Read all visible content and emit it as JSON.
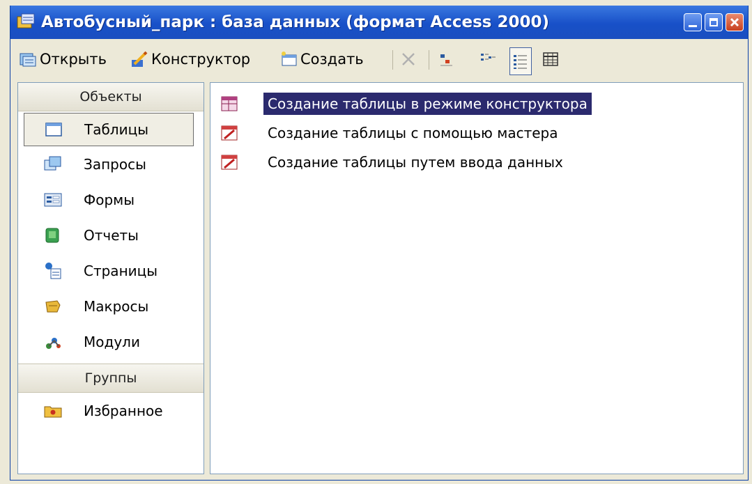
{
  "window": {
    "title": "Автобусный_парк : база данных (формат Access 2000)"
  },
  "toolbar": {
    "open_label": "Открыть",
    "design_label": "Конструктор",
    "create_label": "Создать"
  },
  "objects_panel": {
    "header": "Объекты",
    "items": [
      {
        "label": "Таблицы",
        "icon": "table-icon"
      },
      {
        "label": "Запросы",
        "icon": "query-icon"
      },
      {
        "label": "Формы",
        "icon": "form-icon"
      },
      {
        "label": "Отчеты",
        "icon": "report-icon"
      },
      {
        "label": "Страницы",
        "icon": "page-icon"
      },
      {
        "label": "Макросы",
        "icon": "macro-icon"
      },
      {
        "label": "Модули",
        "icon": "module-icon"
      }
    ],
    "groups_header": "Группы",
    "groups": [
      {
        "label": "Избранное",
        "icon": "favorites-folder-icon"
      }
    ]
  },
  "main_list": {
    "items": [
      {
        "label": "Создание таблицы в режиме конструктора",
        "selected": true
      },
      {
        "label": "Создание таблицы с помощью мастера",
        "selected": false
      },
      {
        "label": "Создание таблицы путем ввода данных",
        "selected": false
      }
    ]
  },
  "colors": {
    "titlebar": "#1850c8",
    "selection": "#2b2a6e",
    "window_bg": "#ece9d8"
  }
}
